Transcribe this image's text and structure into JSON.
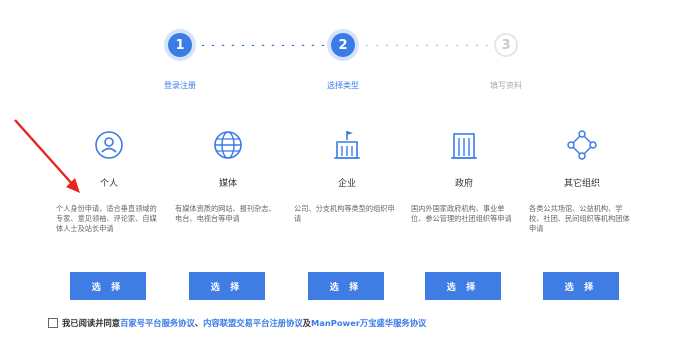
{
  "steps": [
    {
      "number": "1",
      "label": "登录注册"
    },
    {
      "number": "2",
      "label": "选择类型"
    },
    {
      "number": "3",
      "label": "填写资料"
    }
  ],
  "cards": [
    {
      "title": "个人",
      "desc": "个人身份申请，适合垂直领域的专家、意见领袖、评论家、自媒体人士及站长申请",
      "button": "选 择",
      "icon": "user-circle-icon"
    },
    {
      "title": "媒体",
      "desc": "有媒体资质的网站、报刊杂志、电台、电视台等申请",
      "button": "选 择",
      "icon": "globe-icon"
    },
    {
      "title": "企业",
      "desc": "公司、分支机构等类型的组织申请",
      "button": "选 择",
      "icon": "building-flag-icon"
    },
    {
      "title": "政府",
      "desc": "国内外国家政府机构、事业单位、参公管理的社团组织等申请",
      "button": "选 择",
      "icon": "government-building-icon"
    },
    {
      "title": "其它组织",
      "desc": "各类公共场馆、公益机构、学校、社团、民间组织等机构团体申请",
      "button": "选 择",
      "icon": "network-icon"
    }
  ],
  "agreement": {
    "prefix": "我已阅读并同意",
    "link1": "百家号平台服务协议",
    "sep1": "、",
    "link2": "内容联盟交易平台注册协议",
    "sep2": "及",
    "link3": "ManPower万宝盛华服务协议"
  },
  "colors": {
    "accent": "#3b7be8",
    "button": "#3f7de4",
    "arrow": "#e8251f"
  }
}
